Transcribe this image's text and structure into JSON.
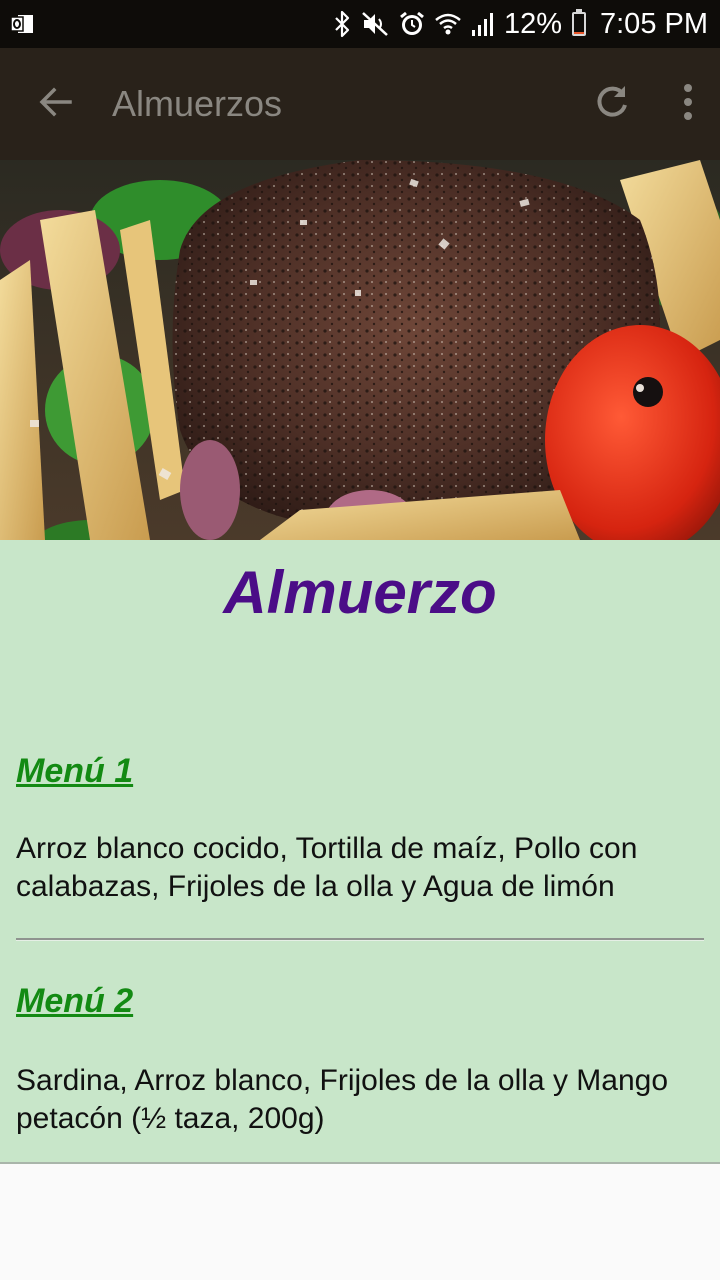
{
  "status_bar": {
    "battery_percent": "12%",
    "time": "7:05 PM",
    "icons": [
      "outlook-icon",
      "bluetooth-icon",
      "mute-icon",
      "alarm-icon",
      "wifi-icon",
      "signal-icon",
      "battery-icon"
    ],
    "battery_level": 0.12,
    "battery_color": "#e8572b"
  },
  "app_bar": {
    "title": "Almuerzos",
    "back_icon": "arrow-back-icon",
    "refresh_icon": "refresh-icon",
    "menu_icon": "more-vert-icon",
    "background": "#29221a"
  },
  "hero": {
    "image": "steak-with-vegetables-photo"
  },
  "content": {
    "title": "Almuerzo",
    "background": "#c8e6c9",
    "menus": [
      {
        "heading": "Menú 1",
        "items": "Arroz blanco cocido, Tortilla de maíz, Pollo con calabazas, Frijoles de la olla y Agua de limón"
      },
      {
        "heading": "Menú 2",
        "items": "Sardina, Arroz blanco, Frijoles de la olla y Mango petacón (½ taza, 200g)"
      }
    ]
  },
  "colors": {
    "title": "#4b0d87",
    "heading": "#138a13",
    "status_bar": "#0e0c09"
  }
}
